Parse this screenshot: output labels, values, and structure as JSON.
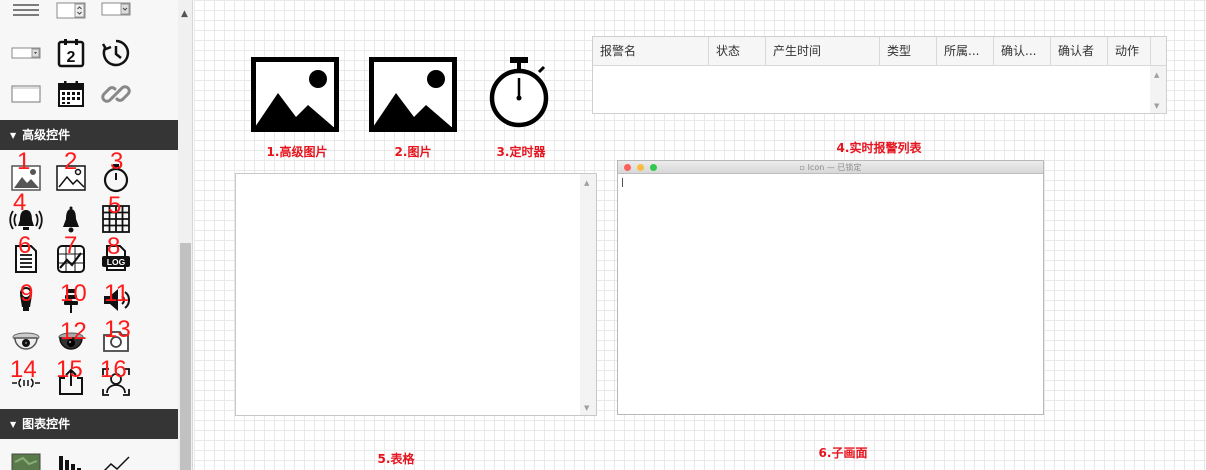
{
  "sidebar": {
    "sections": [
      {
        "title": "高级控件"
      },
      {
        "title": "图表控件"
      }
    ],
    "top_icons": [
      "list-lines-icon",
      "dropdown-select-icon",
      "dropdown-icon",
      "combobox-icon",
      "date-number-icon",
      "clock-history-icon",
      "textbox-icon",
      "calendar-icon",
      "link-icon"
    ],
    "advanced_icons": [
      "advanced-image-icon",
      "image-icon",
      "timer-icon",
      "alarm-siren-icon",
      "bell-icon",
      "table-grid-icon",
      "document-icon",
      "trend-chart-icon",
      "log-icon",
      "traffic-light-icon",
      "light-pole-icon",
      "speaker-icon",
      "dome-camera-icon",
      "dome-camera-dark-icon",
      "camera-icon",
      "signal-icon",
      "export-icon",
      "user-frame-icon"
    ],
    "chart_icons": [
      "map-icon",
      "bar-chart-icon",
      "line-chart-icon"
    ],
    "numbers": [
      "1",
      "2",
      "3",
      "4",
      "5",
      "6",
      "7",
      "8",
      "9",
      "10",
      "11",
      "12",
      "13",
      "14",
      "15",
      "16"
    ]
  },
  "canvas": {
    "captions": {
      "advanced_image": "1.高级图片",
      "image": "2.图片",
      "timer": "3.定时器",
      "alarm_list": "4.实时报警列表",
      "table": "5.表格",
      "subscreen": "6.子画面"
    },
    "alarm_table": {
      "columns": [
        "报警名",
        "状态",
        "产生时间",
        "类型",
        "所属...",
        "确认...",
        "确认者",
        "动作"
      ]
    },
    "subwindow": {
      "title": "Icon — 已锁定"
    }
  },
  "colors": {
    "caption": "#e6141e",
    "number": "#ff1a1a",
    "section_header": "#353535"
  }
}
